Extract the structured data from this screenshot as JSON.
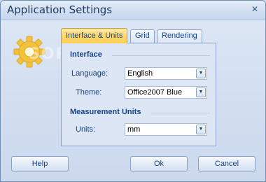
{
  "window": {
    "title": "Application Settings",
    "close_glyph": "✕"
  },
  "icons": {
    "logo": "gear-icon",
    "close": "close-icon",
    "dropdown": "chevron-down-icon"
  },
  "watermark": "SOFTPEDIA",
  "tabs": [
    {
      "label": "Interface & Units",
      "active": true
    },
    {
      "label": "Grid",
      "active": false
    },
    {
      "label": "Rendering",
      "active": false
    }
  ],
  "interface": {
    "section_title": "Interface",
    "language": {
      "label": "Language:",
      "value": "English"
    },
    "theme": {
      "label": "Theme:",
      "value": "Office2007 Blue"
    }
  },
  "measurement": {
    "section_title": "Measurement Units",
    "units": {
      "label": "Units:",
      "value": "mm"
    }
  },
  "buttons": {
    "help": "Help",
    "ok": "Ok",
    "cancel": "Cancel"
  },
  "colors": {
    "accent_tab": "#ffd667",
    "text": "#15428b",
    "logo": "#f5c842"
  }
}
